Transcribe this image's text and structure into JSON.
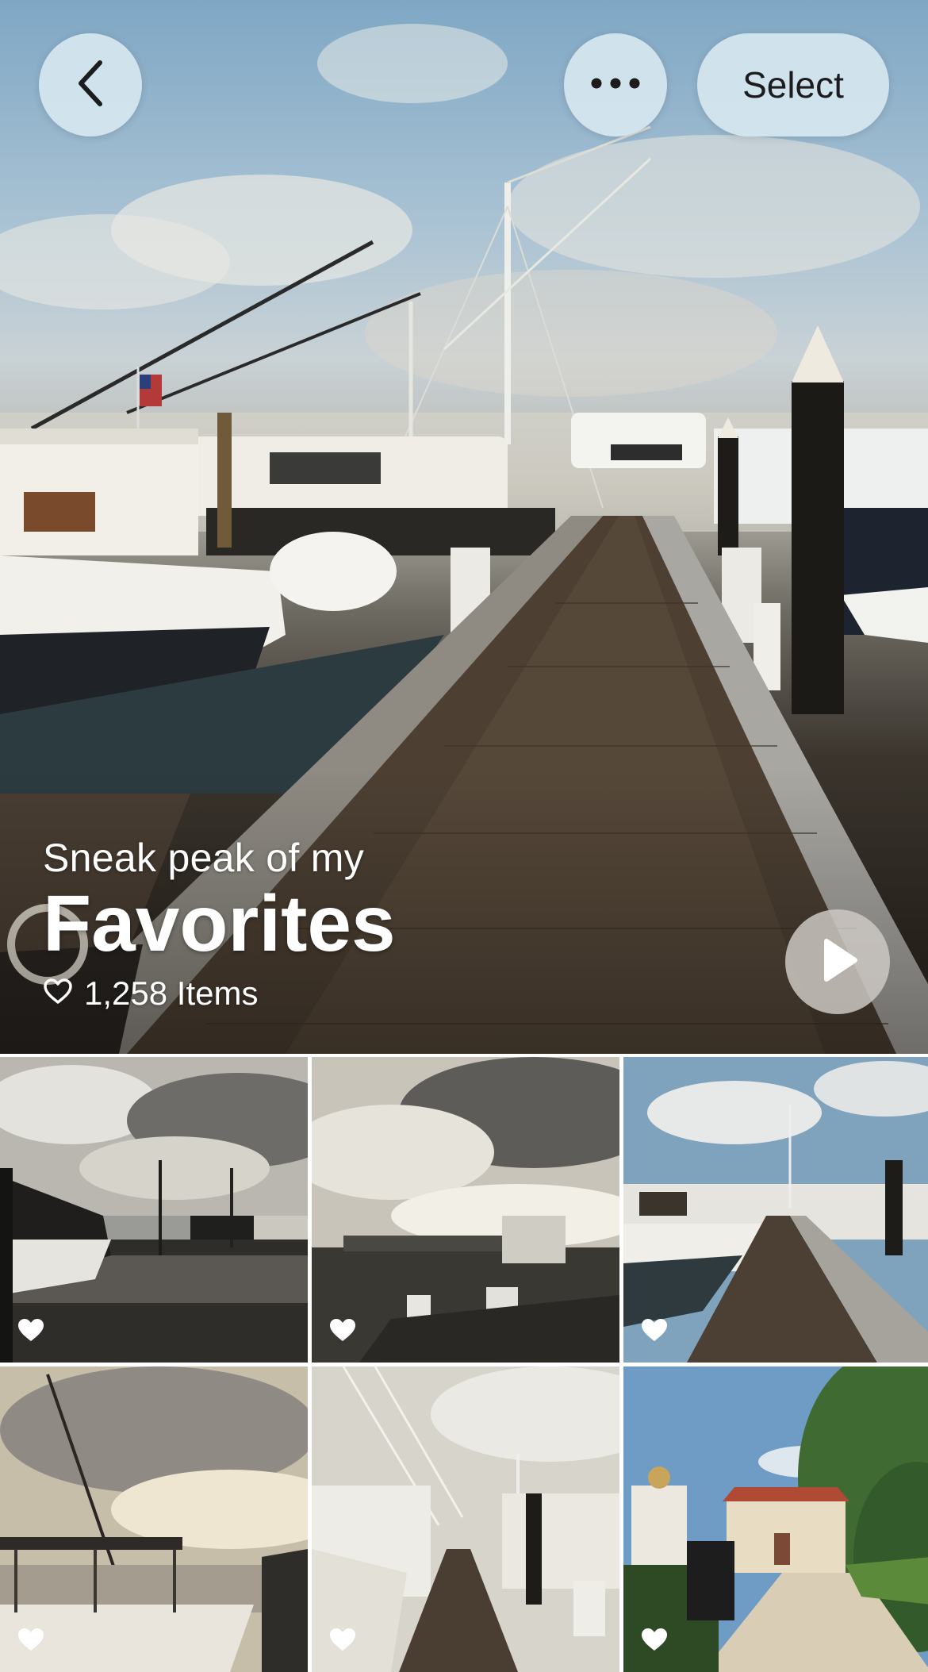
{
  "header": {
    "back_icon": "chevron-left-icon",
    "more_icon": "ellipsis-icon",
    "select_label": "Select"
  },
  "album": {
    "subtitle": "Sneak peak of my",
    "title": "Favorites",
    "count_text": "1,258 Items",
    "count_icon": "heart-outline-icon",
    "play_icon": "play-icon"
  },
  "grid": {
    "tiles": [
      {
        "name": "photo-1",
        "favorite": true
      },
      {
        "name": "photo-2",
        "favorite": true
      },
      {
        "name": "photo-3",
        "favorite": true
      },
      {
        "name": "photo-4",
        "favorite": true
      },
      {
        "name": "photo-5",
        "favorite": true
      },
      {
        "name": "photo-6",
        "favorite": true
      }
    ],
    "favorite_icon": "heart-filled-icon"
  },
  "colors": {
    "button_bg": "#d6e7f0",
    "text_light": "#ffffff",
    "text_dark": "#1c1c1e"
  }
}
